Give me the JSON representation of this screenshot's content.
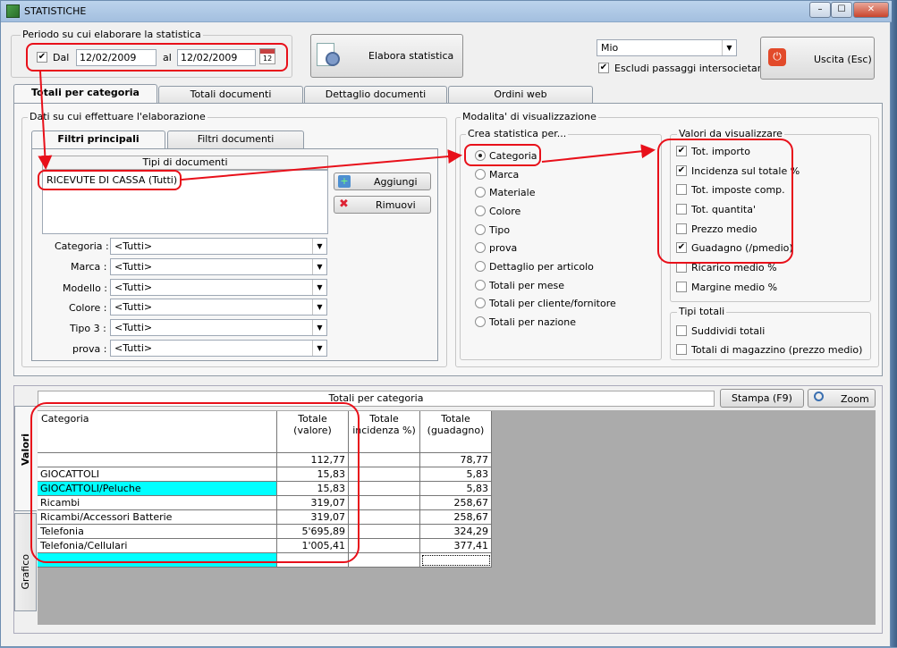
{
  "window": {
    "title": "STATISTICHE",
    "minimize": "–",
    "maximize": "☐",
    "close": "✕"
  },
  "period": {
    "group_label": "Periodo su cui elaborare la statistica",
    "enabled": true,
    "from_label": "Dal",
    "from_value": "12/02/2009",
    "to_label": "al",
    "to_value": "12/02/2009"
  },
  "elabora_button": "Elabora statistica",
  "profile": {
    "selected": "Mio",
    "exclude_label": "Escludi passaggi intersocietari",
    "exclude_checked": true
  },
  "exit_button": "Uscita (Esc)",
  "main_tabs": [
    "Totali per categoria",
    "Totali documenti",
    "Dettaglio documenti",
    "Ordini web"
  ],
  "filters": {
    "group_label": "Dati su cui effettuare l'elaborazione",
    "tabs": [
      "Filtri principali",
      "Filtri documenti"
    ],
    "doc_types_header": "Tipi di documenti",
    "doc_types": [
      "RICEVUTE DI CASSA (Tutti)"
    ],
    "add_button": "Aggiungi",
    "remove_button": "Rimuovi",
    "fields": [
      {
        "label": "Categoria :",
        "value": "<Tutti>"
      },
      {
        "label": "Marca :",
        "value": "<Tutti>"
      },
      {
        "label": "Modello :",
        "value": "<Tutti>"
      },
      {
        "label": "Colore :",
        "value": "<Tutti>"
      },
      {
        "label": "Tipo 3 :",
        "value": "<Tutti>"
      },
      {
        "label": "prova :",
        "value": "<Tutti>"
      }
    ]
  },
  "display": {
    "group_label": "Modalita' di visualizzazione",
    "create_label": "Crea statistica per...",
    "create_options": [
      "Categoria",
      "Marca",
      "Materiale",
      "Colore",
      "Tipo",
      "prova",
      "Dettaglio per articolo",
      "Totali per mese",
      "Totali per cliente/fornitore",
      "Totali per nazione"
    ],
    "create_selected": "Categoria",
    "values_label": "Valori da visualizzare",
    "values": [
      {
        "label": "Tot. importo",
        "checked": true
      },
      {
        "label": "Incidenza sul totale %",
        "checked": true
      },
      {
        "label": "Tot. imposte comp.",
        "checked": false
      },
      {
        "label": "Tot. quantita'",
        "checked": false
      },
      {
        "label": "Prezzo medio",
        "checked": false
      },
      {
        "label": "Guadagno (/pmedio)",
        "checked": true
      },
      {
        "label": "Ricarico medio %",
        "checked": false
      },
      {
        "label": "Margine medio %",
        "checked": false
      }
    ],
    "totals_label": "Tipi totali",
    "totals": [
      {
        "label": "Suddividi totali",
        "checked": false
      },
      {
        "label": "Totali di magazzino (prezzo medio)",
        "checked": false
      }
    ]
  },
  "results": {
    "side_tabs": [
      "Valori",
      "Grafico"
    ],
    "title": "Totali per categoria",
    "print_button": "Stampa (F9)",
    "zoom_button": "Zoom",
    "columns": [
      "Categoria",
      "Totale\n(valore)",
      "Totale\nincidenza %)",
      "Totale\n(guadagno)"
    ],
    "rows": [
      {
        "cat": "",
        "valore": "112,77",
        "incidenza": "",
        "guadagno": "78,77"
      },
      {
        "cat": "GIOCATTOLI",
        "valore": "15,83",
        "incidenza": "",
        "guadagno": "5,83"
      },
      {
        "cat": "GIOCATTOLI/Peluche",
        "valore": "15,83",
        "incidenza": "",
        "guadagno": "5,83"
      },
      {
        "cat": "Ricambi",
        "valore": "319,07",
        "incidenza": "",
        "guadagno": "258,67"
      },
      {
        "cat": "Ricambi/Accessori Batterie",
        "valore": "319,07",
        "incidenza": "",
        "guadagno": "258,67"
      },
      {
        "cat": "Telefonia",
        "valore": "5'695,89",
        "incidenza": "",
        "guadagno": "324,29"
      },
      {
        "cat": "Telefonia/Cellulari",
        "valore": "1'005,41",
        "incidenza": "",
        "guadagno": "377,41"
      },
      {
        "cat": "",
        "valore": "",
        "incidenza": "",
        "guadagno": ""
      }
    ]
  },
  "colors": {
    "highlight": "#00ffff",
    "annotation": "#e8101a",
    "grid_bg": "#ababab"
  }
}
